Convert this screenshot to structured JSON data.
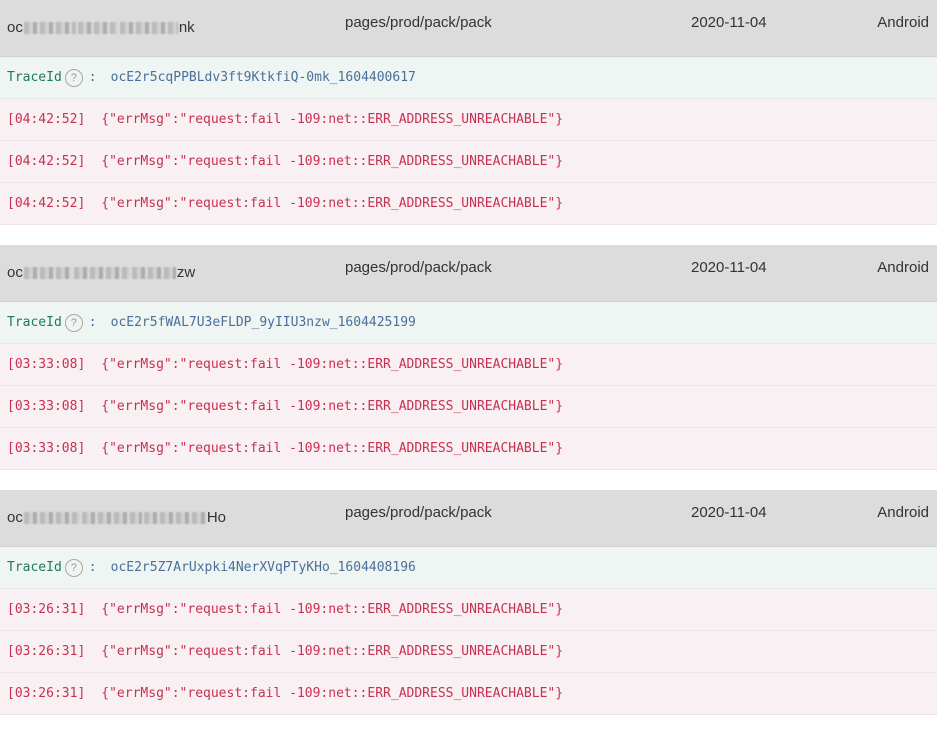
{
  "records": [
    {
      "user_prefix": "oc",
      "user_suffix": "nk",
      "page": "pages/prod/pack/pack",
      "date": "2020-11-04",
      "os": "Android",
      "trace_label": "TraceId",
      "trace_help": "?",
      "trace_sep": ":",
      "trace_id": "ocE2r5cqPPBLdv3ft9KtkfiQ-0mk_1604400617",
      "logs": [
        {
          "time": "[04:42:52]",
          "message": "{\"errMsg\":\"request:fail -109:net::ERR_ADDRESS_UNREACHABLE\"}"
        },
        {
          "time": "[04:42:52]",
          "message": "{\"errMsg\":\"request:fail -109:net::ERR_ADDRESS_UNREACHABLE\"}"
        },
        {
          "time": "[04:42:52]",
          "message": "{\"errMsg\":\"request:fail -109:net::ERR_ADDRESS_UNREACHABLE\"}"
        }
      ]
    },
    {
      "user_prefix": "oc",
      "user_suffix": "zw",
      "page": "pages/prod/pack/pack",
      "date": "2020-11-04",
      "os": "Android",
      "trace_label": "TraceId",
      "trace_help": "?",
      "trace_sep": ":",
      "trace_id": "ocE2r5fWAL7U3eFLDP_9yIIU3nzw_1604425199",
      "logs": [
        {
          "time": "[03:33:08]",
          "message": "{\"errMsg\":\"request:fail -109:net::ERR_ADDRESS_UNREACHABLE\"}"
        },
        {
          "time": "[03:33:08]",
          "message": "{\"errMsg\":\"request:fail -109:net::ERR_ADDRESS_UNREACHABLE\"}"
        },
        {
          "time": "[03:33:08]",
          "message": "{\"errMsg\":\"request:fail -109:net::ERR_ADDRESS_UNREACHABLE\"}"
        }
      ]
    },
    {
      "user_prefix": "oc",
      "user_suffix": "Ho",
      "page": "pages/prod/pack/pack",
      "date": "2020-11-04",
      "os": "Android",
      "trace_label": "TraceId",
      "trace_help": "?",
      "trace_sep": ":",
      "trace_id": "ocE2r5Z7ArUxpki4NerXVqPTyKHo_1604408196",
      "logs": [
        {
          "time": "[03:26:31]",
          "message": "{\"errMsg\":\"request:fail -109:net::ERR_ADDRESS_UNREACHABLE\"}"
        },
        {
          "time": "[03:26:31]",
          "message": "{\"errMsg\":\"request:fail -109:net::ERR_ADDRESS_UNREACHABLE\"}"
        },
        {
          "time": "[03:26:31]",
          "message": "{\"errMsg\":\"request:fail -109:net::ERR_ADDRESS_UNREACHABLE\"}"
        }
      ]
    }
  ],
  "colors": {
    "header_bg": "#dcdcdc",
    "trace_bg": "#eef5f2",
    "trace_label": "#1f7a58",
    "trace_value": "#4a6f9a",
    "log_bg": "#f8f0f2",
    "log_text": "#c83050"
  },
  "icons": {
    "help": "help-circle-icon"
  }
}
